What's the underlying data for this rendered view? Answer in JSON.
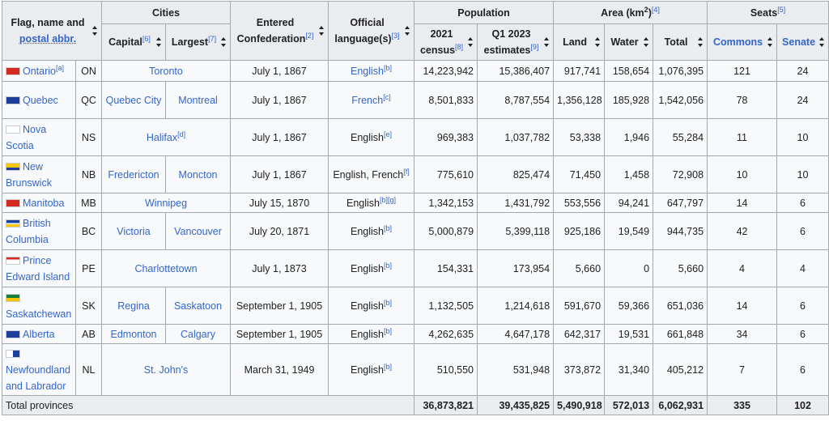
{
  "headers": {
    "flag_name_l1": "Flag, name and",
    "flag_name_l2": "postal abbr.",
    "cities": "Cities",
    "entered_l1": "Entered",
    "entered_l2": "Confederation",
    "entered_sup": "[2]",
    "official_l1": "Official",
    "official_l2": "language(s)",
    "official_sup": "[3]",
    "population": "Population",
    "area_pre": "Area (km",
    "area_exp": "2",
    "area_post": ")",
    "area_sup": "[4]",
    "seats": "Seats",
    "seats_sup": "[5]",
    "capital": "Capital",
    "capital_sup": "[6]",
    "largest": "Largest",
    "largest_sup": "[7]",
    "census_l1": "2021",
    "census_l2": "census",
    "census_sup": "[8]",
    "est_l1": "Q1 2023",
    "est_l2": "estimates",
    "est_sup": "[9]",
    "land": "Land",
    "water": "Water",
    "total": "Total",
    "commons": "Commons",
    "senate": "Senate"
  },
  "rows": [
    {
      "name": "Ontario",
      "name_sup": "[a]",
      "abbr": "ON",
      "capital": "Toronto",
      "largest": "",
      "entered": "July 1, 1867",
      "lang": "English",
      "lang_sup": "[b]",
      "census": "14,223,942",
      "est": "15,386,407",
      "land": "917,741",
      "water": "158,654",
      "total": "1,076,395",
      "commons": "121",
      "senate": "24"
    },
    {
      "name": "Quebec",
      "name_sup": "",
      "abbr": "QC",
      "capital": "Quebec City",
      "largest": "Montreal",
      "entered": "July 1, 1867",
      "lang": "French",
      "lang_sup": "[c]",
      "census": "8,501,833",
      "est": "8,787,554",
      "land": "1,356,128",
      "water": "185,928",
      "total": "1,542,056",
      "commons": "78",
      "senate": "24"
    },
    {
      "name": "Nova Scotia",
      "name_sup": "",
      "abbr": "NS",
      "capital": "Halifax",
      "capital_sup": "[d]",
      "largest": "",
      "entered": "July 1, 1867",
      "lang": "English",
      "lang_sup": "[e]",
      "census": "969,383",
      "est": "1,037,782",
      "land": "53,338",
      "water": "1,946",
      "total": "55,284",
      "commons": "11",
      "senate": "10"
    },
    {
      "name": "New Brunswick",
      "name_sup": "",
      "abbr": "NB",
      "capital": "Fredericton",
      "largest": "Moncton",
      "entered": "July 1, 1867",
      "lang": "English, French",
      "lang_sup": "[f]",
      "census": "775,610",
      "est": "825,474",
      "land": "71,450",
      "water": "1,458",
      "total": "72,908",
      "commons": "10",
      "senate": "10"
    },
    {
      "name": "Manitoba",
      "name_sup": "",
      "abbr": "MB",
      "capital": "Winnipeg",
      "largest": "",
      "entered": "July 15, 1870",
      "lang": "English",
      "lang_sup": "[b][g]",
      "census": "1,342,153",
      "est": "1,431,792",
      "land": "553,556",
      "water": "94,241",
      "total": "647,797",
      "commons": "14",
      "senate": "6"
    },
    {
      "name": "British Columbia",
      "name_sup": "",
      "abbr": "BC",
      "capital": "Victoria",
      "largest": "Vancouver",
      "entered": "July 20, 1871",
      "lang": "English",
      "lang_sup": "[b]",
      "census": "5,000,879",
      "est": "5,399,118",
      "land": "925,186",
      "water": "19,549",
      "total": "944,735",
      "commons": "42",
      "senate": "6"
    },
    {
      "name": "Prince Edward Island",
      "name_sup": "",
      "abbr": "PE",
      "capital": "Charlottetown",
      "largest": "",
      "entered": "July 1, 1873",
      "lang": "English",
      "lang_sup": "[b]",
      "census": "154,331",
      "est": "173,954",
      "land": "5,660",
      "water": "0",
      "total": "5,660",
      "commons": "4",
      "senate": "4"
    },
    {
      "name": "Saskatchewan",
      "name_sup": "",
      "abbr": "SK",
      "capital": "Regina",
      "largest": "Saskatoon",
      "entered": "September 1, 1905",
      "lang": "English",
      "lang_sup": "[b]",
      "census": "1,132,505",
      "est": "1,214,618",
      "land": "591,670",
      "water": "59,366",
      "total": "651,036",
      "commons": "14",
      "senate": "6"
    },
    {
      "name": "Alberta",
      "name_sup": "",
      "abbr": "AB",
      "capital": "Edmonton",
      "largest": "Calgary",
      "entered": "September 1, 1905",
      "lang": "English",
      "lang_sup": "[b]",
      "census": "4,262,635",
      "est": "4,647,178",
      "land": "642,317",
      "water": "19,531",
      "total": "661,848",
      "commons": "34",
      "senate": "6"
    },
    {
      "name": "Newfoundland and Labrador",
      "name_sup": "",
      "abbr": "NL",
      "capital": "St. John's",
      "largest": "",
      "entered": "March 31, 1949",
      "lang": "English",
      "lang_sup": "[b]",
      "census": "510,550",
      "est": "531,948",
      "land": "373,872",
      "water": "31,340",
      "total": "405,212",
      "commons": "7",
      "senate": "6"
    }
  ],
  "totals": {
    "label": "Total provinces",
    "census": "36,873,821",
    "est": "39,435,825",
    "land": "5,490,918",
    "water": "572,013",
    "total": "6,062,931",
    "commons": "335",
    "senate": "102"
  },
  "colors": {
    "link": "#3366cc",
    "header_bg": "#eaecf0",
    "cell_bg": "#f8f9fa",
    "border": "#a2a9b1"
  }
}
